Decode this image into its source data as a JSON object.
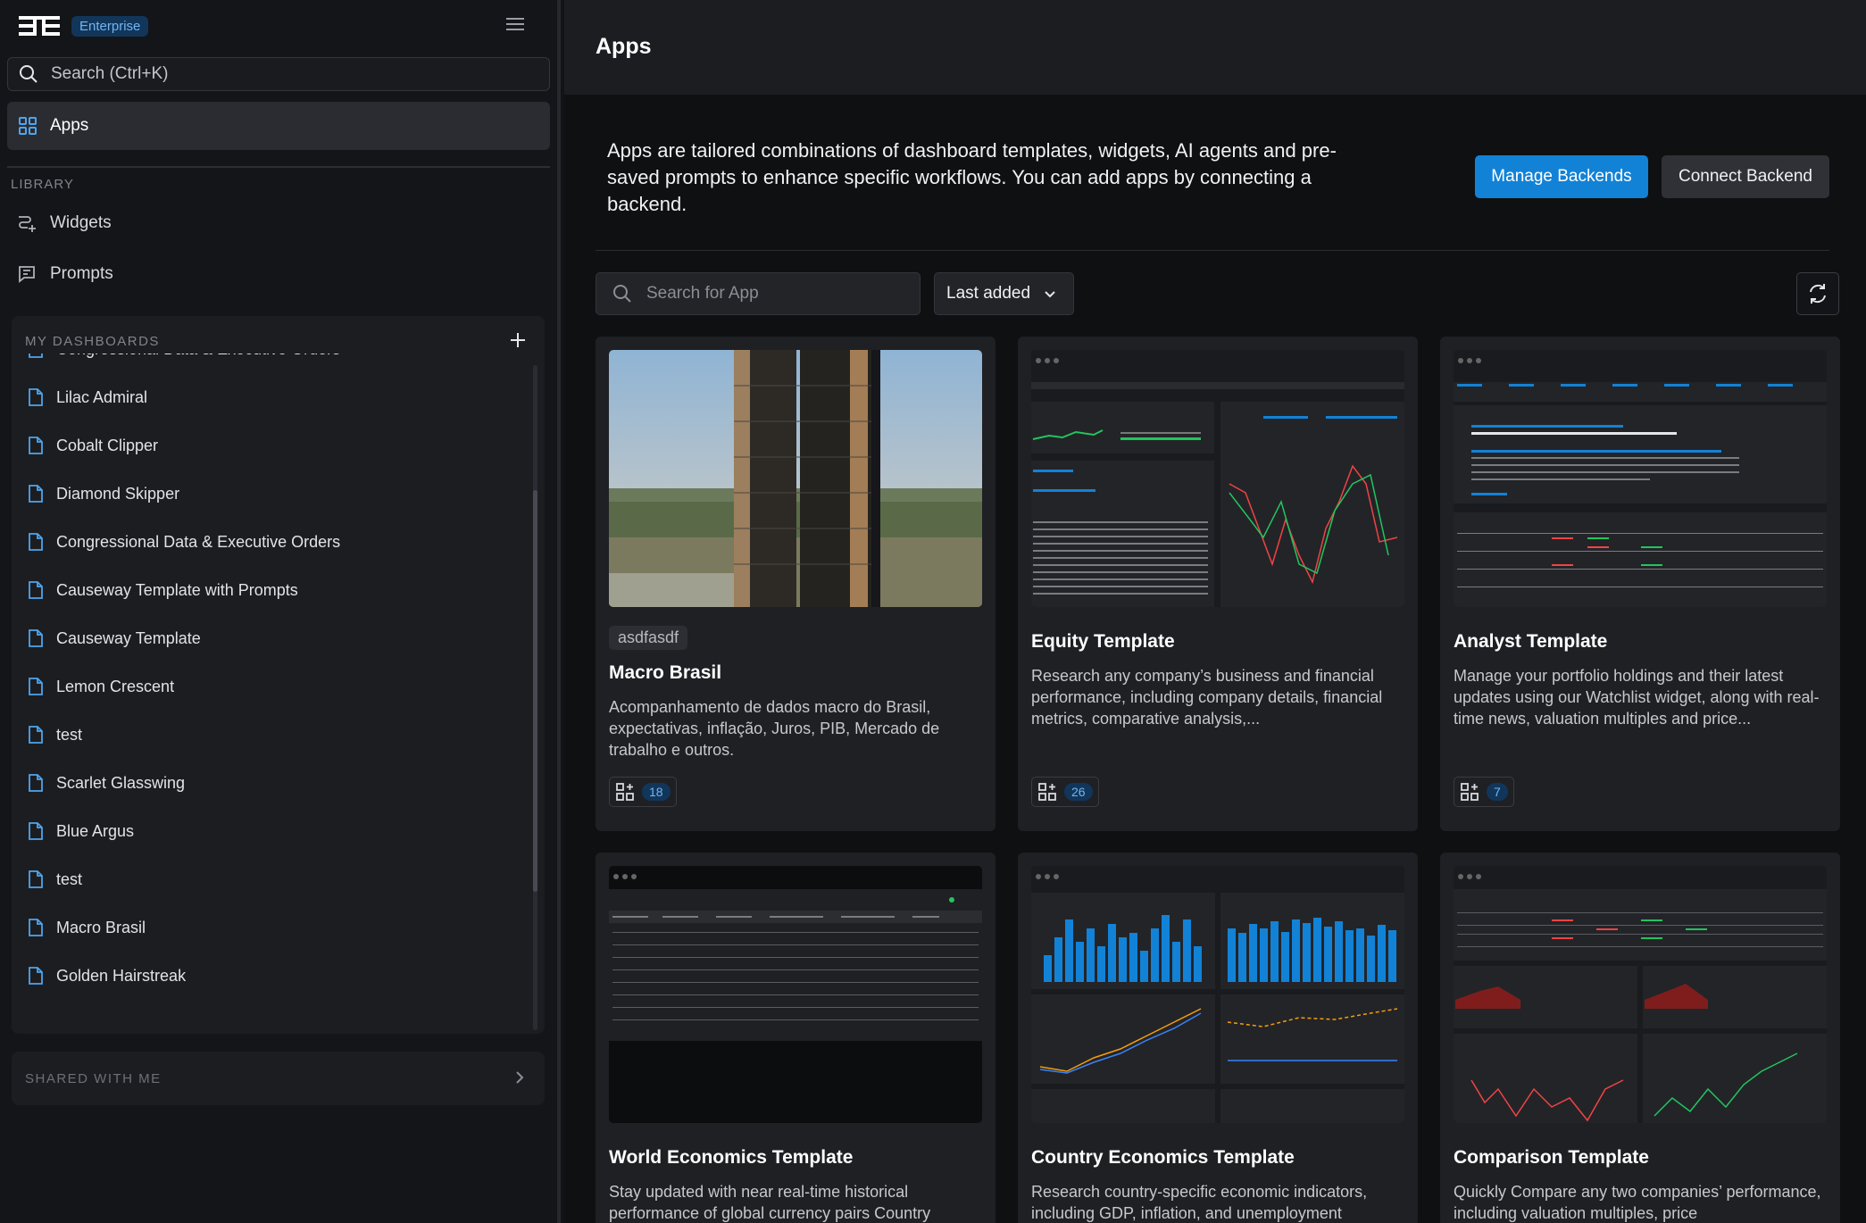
{
  "brand": {
    "edition_badge": "Enterprise"
  },
  "sidebar": {
    "search_placeholder": "Search (Ctrl+K)",
    "active_nav": {
      "label": "Apps"
    },
    "library_title": "LIBRARY",
    "library_items": [
      {
        "label": "Widgets",
        "icon": "widgets-icon"
      },
      {
        "label": "Prompts",
        "icon": "prompts-icon"
      }
    ],
    "dashboards_title": "MY DASHBOARDS",
    "dashboards": [
      "Congressional Data & Executive Orders",
      "Lilac Admiral",
      "Cobalt Clipper",
      "Diamond Skipper",
      "Congressional Data & Executive Orders",
      "Causeway Template with Prompts",
      "Causeway Template",
      "Lemon Crescent",
      "test",
      "Scarlet Glasswing",
      "Blue Argus",
      "test",
      "Macro Brasil",
      "Golden Hairstreak"
    ],
    "shared_title": "SHARED WITH ME"
  },
  "header": {
    "title": "Apps"
  },
  "main": {
    "intro": "Apps are tailored combinations of dashboard templates, widgets, AI agents and pre-saved prompts to enhance specific workflows. You can add apps by connecting a backend.",
    "manage_label": "Manage Backends",
    "connect_label": "Connect Backend",
    "search_placeholder": "Search for App",
    "sort_label": "Last added"
  },
  "cards": [
    {
      "tag": "asdfasdf",
      "title": "Macro Brasil",
      "desc": "Acompanhamento de dados macro do Brasil, expectativas, inflação, Juros, PIB, Mercado de trabalho e outros.",
      "count": "18",
      "thumb": "photo"
    },
    {
      "title": "Equity Template",
      "desc": "Research any company’s business and financial performance, including company details, financial metrics, comparative analysis,...",
      "count": "26",
      "thumb": "equity"
    },
    {
      "title": "Analyst Template",
      "desc": "Manage your portfolio holdings and their latest updates using our Watchlist widget, along with real-time news, valuation multiples and price...",
      "count": "7",
      "thumb": "analyst"
    },
    {
      "title": "World Economics Template",
      "desc": "Stay updated with near real-time historical performance of global currency pairs Country",
      "thumb": "world"
    },
    {
      "title": "Country Economics Template",
      "desc": "Research country-specific economic indicators, including GDP, inflation, and unemployment",
      "thumb": "country"
    },
    {
      "title": "Comparison Template",
      "desc": "Quickly Compare any two companies’ performance, including valuation multiples, price",
      "thumb": "comparison"
    }
  ],
  "colors": {
    "accent": "#1282d6",
    "badge_bg": "#12365a",
    "badge_text": "#6fb6f2",
    "up": "#22c55e",
    "down": "#ef4444"
  }
}
